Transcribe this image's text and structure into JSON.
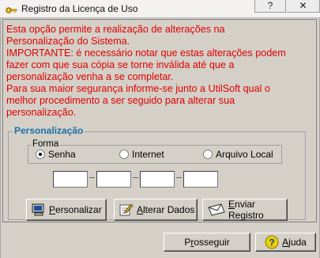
{
  "window": {
    "title": "Registro da Licença de Uso",
    "help_glyph": "?",
    "close_glyph": "✕",
    "icon": "key-icon"
  },
  "notice": {
    "lines": [
      "Esta opção permite a realização de alterações na",
      "Personalização do Sistema.",
      "IMPORTANTE: é necessário notar que estas alterações podem",
      "fazer com que sua cópia se torne inválida até que a",
      "personalização venha a se completar.",
      "Para sua maior segurança informe-se junto a UtilSoft qual o",
      "melhor procedimento a ser seguido para alterar sua",
      "personalização."
    ],
    "color": "#e00000"
  },
  "personalizacao": {
    "title": "Personalização",
    "title_color": "#1c6ea4",
    "forma": {
      "title": "Forma",
      "options": [
        "Senha",
        "Internet",
        "Arquivo Local"
      ],
      "selected": "Senha"
    },
    "fields": [
      "",
      "",
      "",
      ""
    ]
  },
  "actions": {
    "personalizar": {
      "accel": "P",
      "rest": "ersonalizar",
      "icon": "computer-icon"
    },
    "alterar": {
      "accel": "A",
      "rest": "lterar Dados",
      "icon": "pencil-icon"
    },
    "enviar": {
      "accel": "E",
      "rest": "nviar Registro",
      "icon": "envelope-icon"
    }
  },
  "footer": {
    "prosseguir_pre": "P",
    "prosseguir_accel": "r",
    "prosseguir_rest": "osseguir",
    "ajuda_accel": "A",
    "ajuda_rest": "juda",
    "ajuda_icon": "help-icon"
  }
}
